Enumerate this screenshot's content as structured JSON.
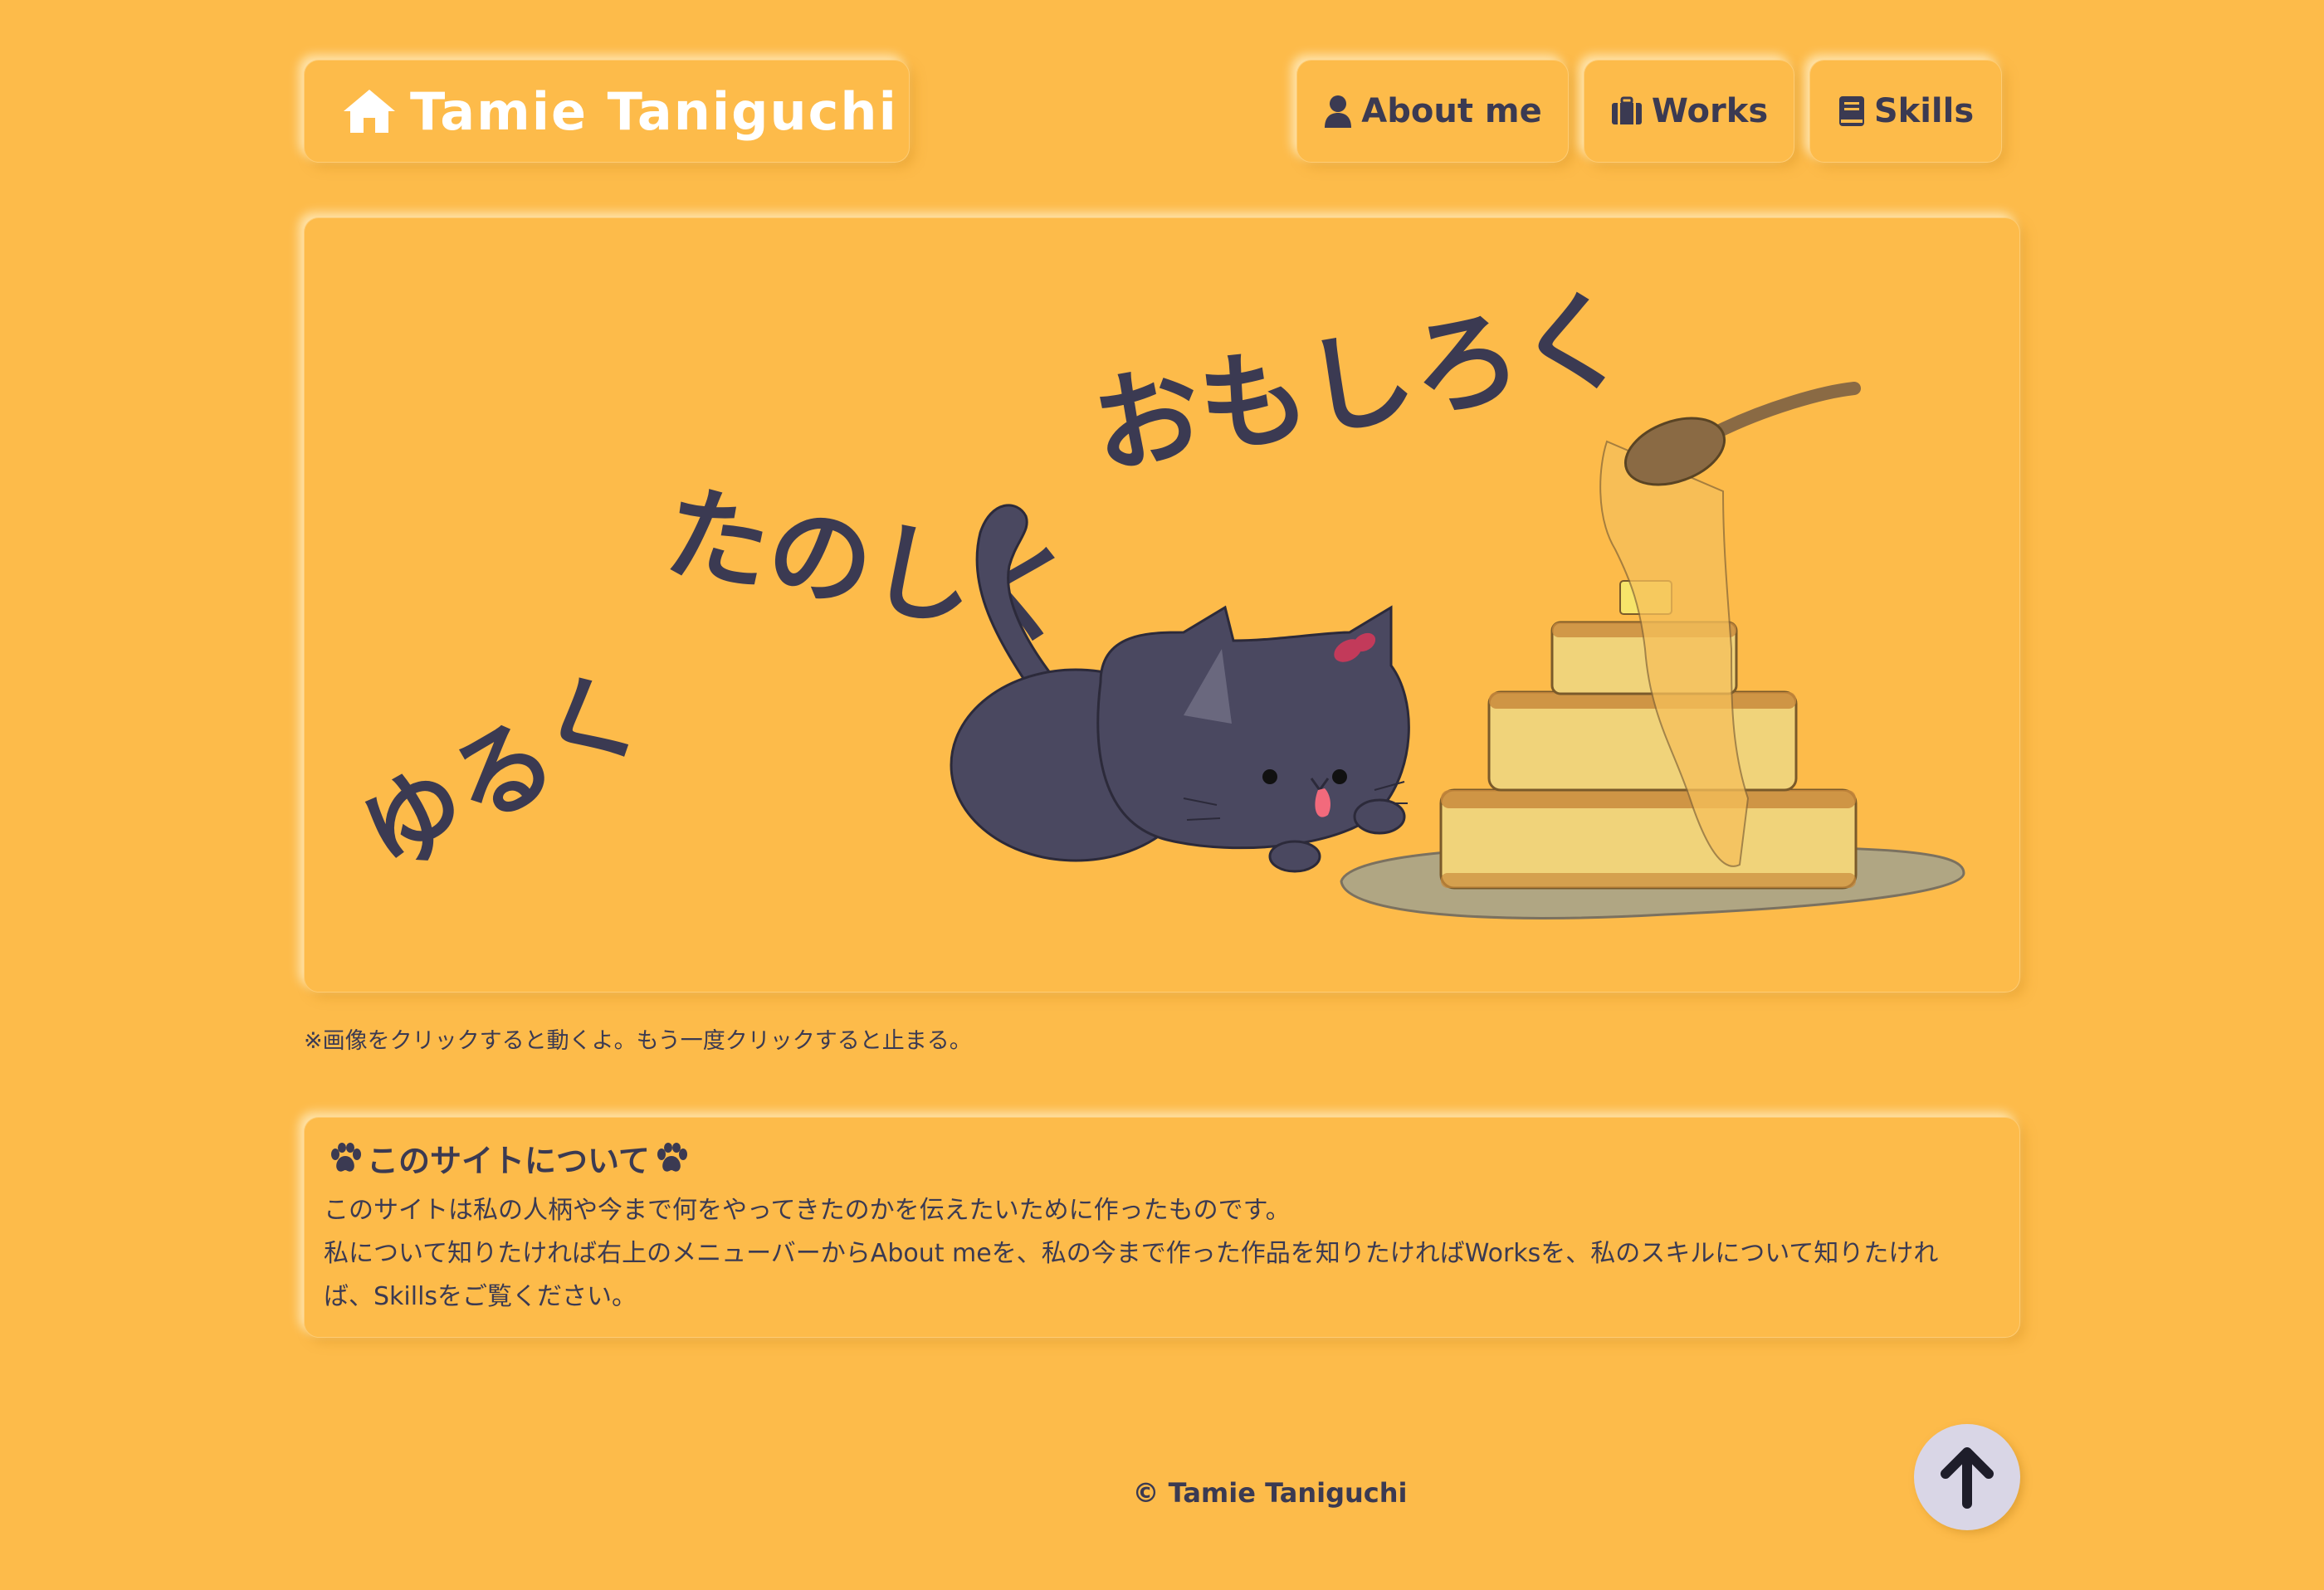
{
  "header": {
    "brand": "Tamie Taniguchi",
    "nav": [
      {
        "label": "About me",
        "icon": "user-icon"
      },
      {
        "label": "Works",
        "icon": "briefcase-icon"
      },
      {
        "label": "Skills",
        "icon": "book-icon"
      }
    ]
  },
  "hero": {
    "words": [
      "ゆるく",
      "たのしく",
      "おもしろく"
    ]
  },
  "note": "※画像をクリックすると動くよ。もう一度クリックすると止まる。",
  "about": {
    "title": "このサイトについて",
    "lines": [
      "このサイトは私の人柄や今まで何をやってきたのかを伝えたいために作ったものです。",
      "私について知りたければ右上のメニューバーからAbout meを、私の今まで作った作品を知りたければWorksを、私のスキルについて知りたけれ",
      "ば、Skillsをご覧ください。"
    ]
  },
  "footer": {
    "copyright": "© Tamie Taniguchi"
  },
  "colors": {
    "background": "#fdbb4a",
    "text": "#3b3a52",
    "scroll_top_button": "#d9d6e6"
  }
}
